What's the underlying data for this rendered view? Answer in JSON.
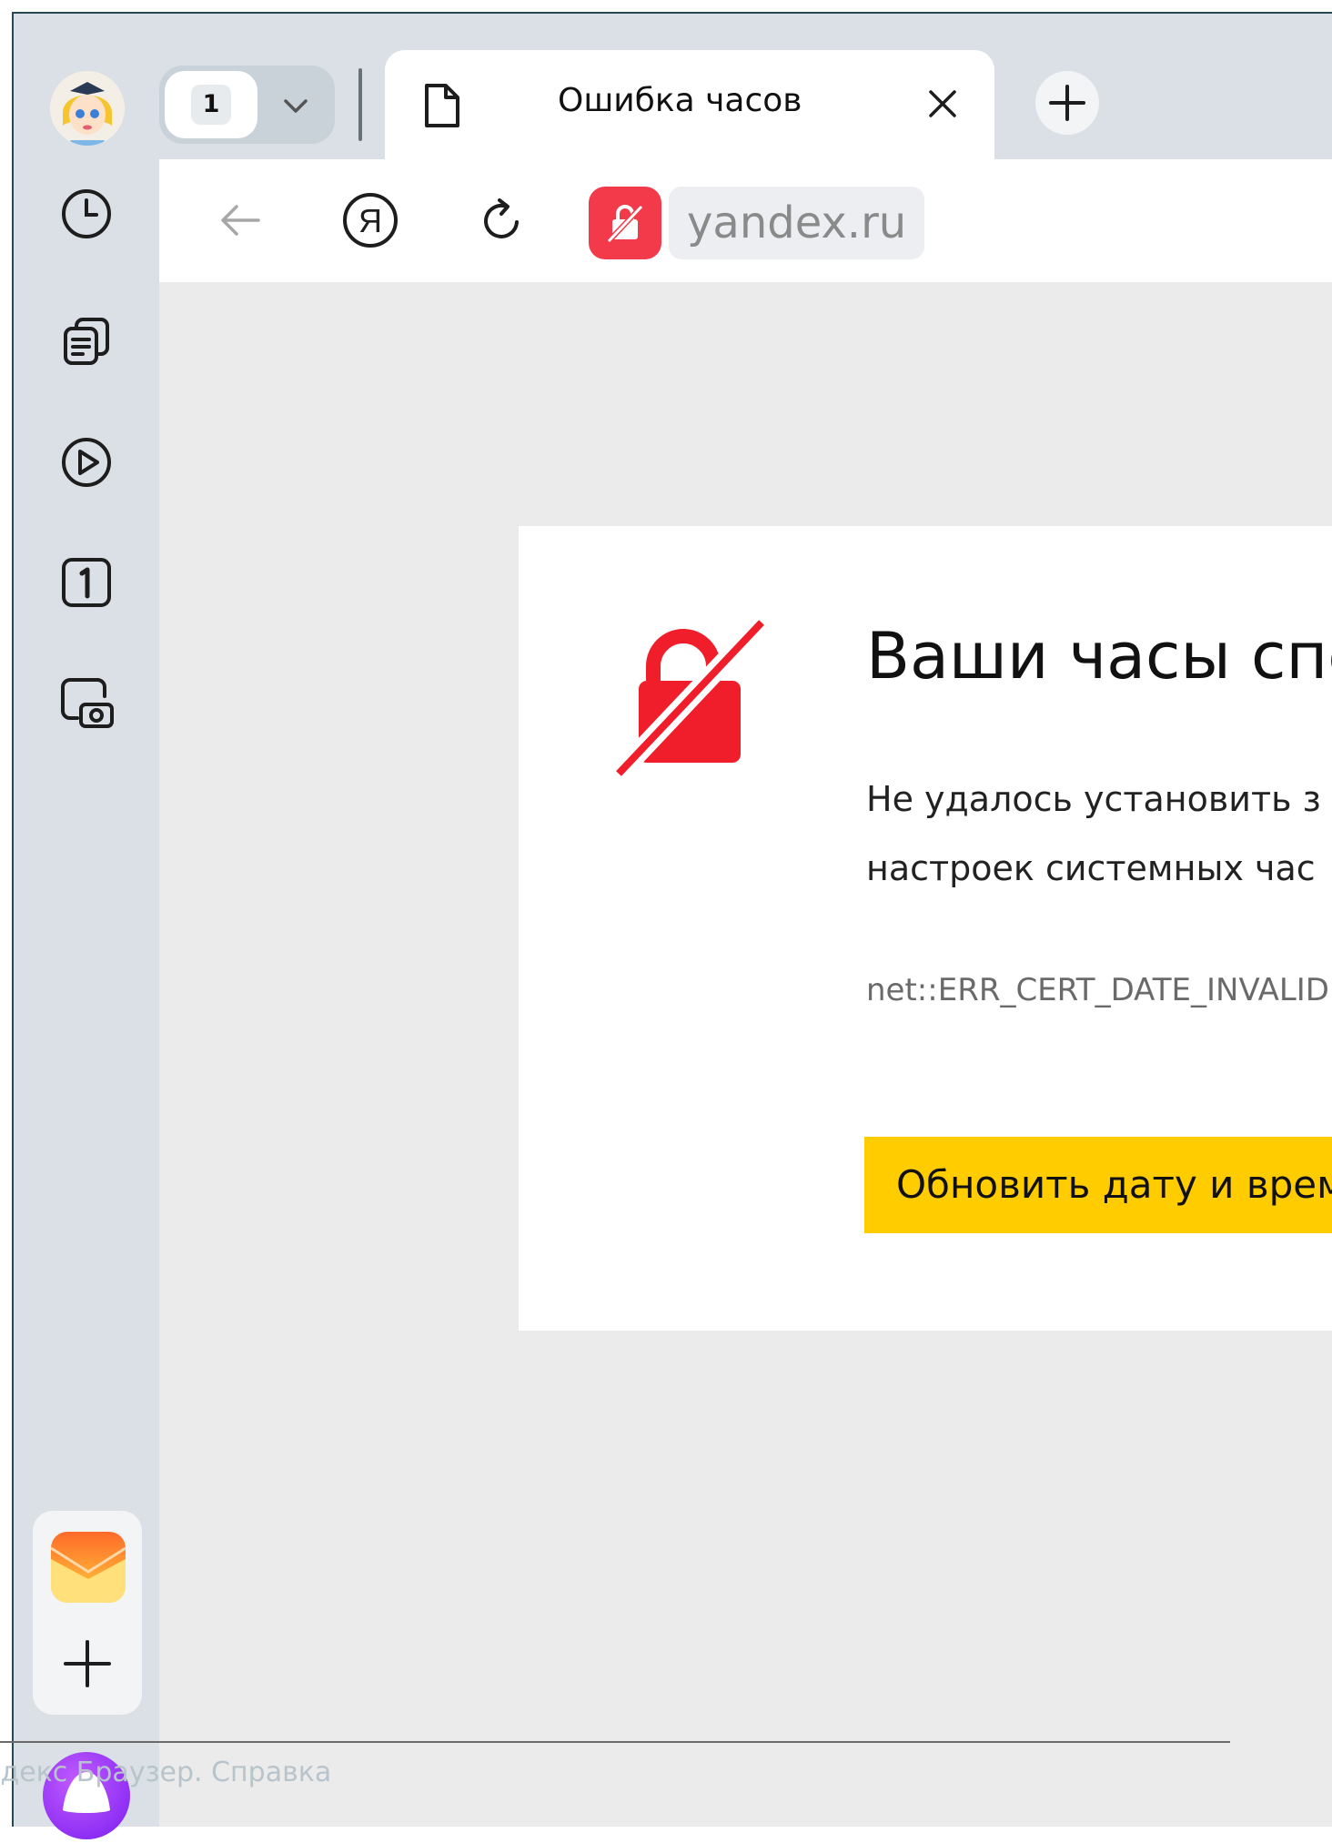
{
  "tabs": {
    "count": "1",
    "active_tab": {
      "title": "Ошибка часов"
    }
  },
  "toolbar": {
    "address_host": "yandex.ru"
  },
  "error_page": {
    "title": "Ваши часы спе",
    "description_line1": "Не удалось установить з",
    "description_line2": "настроек системных час",
    "error_code": "net::ERR_CERT_DATE_INVALID",
    "action_button": "Обновить дату и врем"
  },
  "footer": {
    "help_text": "Яндекс Браузер. Справка"
  },
  "colors": {
    "accent_yellow": "#ffcc00",
    "error_red": "#f01e2a",
    "sidebar_bg": "#dae0e6"
  }
}
